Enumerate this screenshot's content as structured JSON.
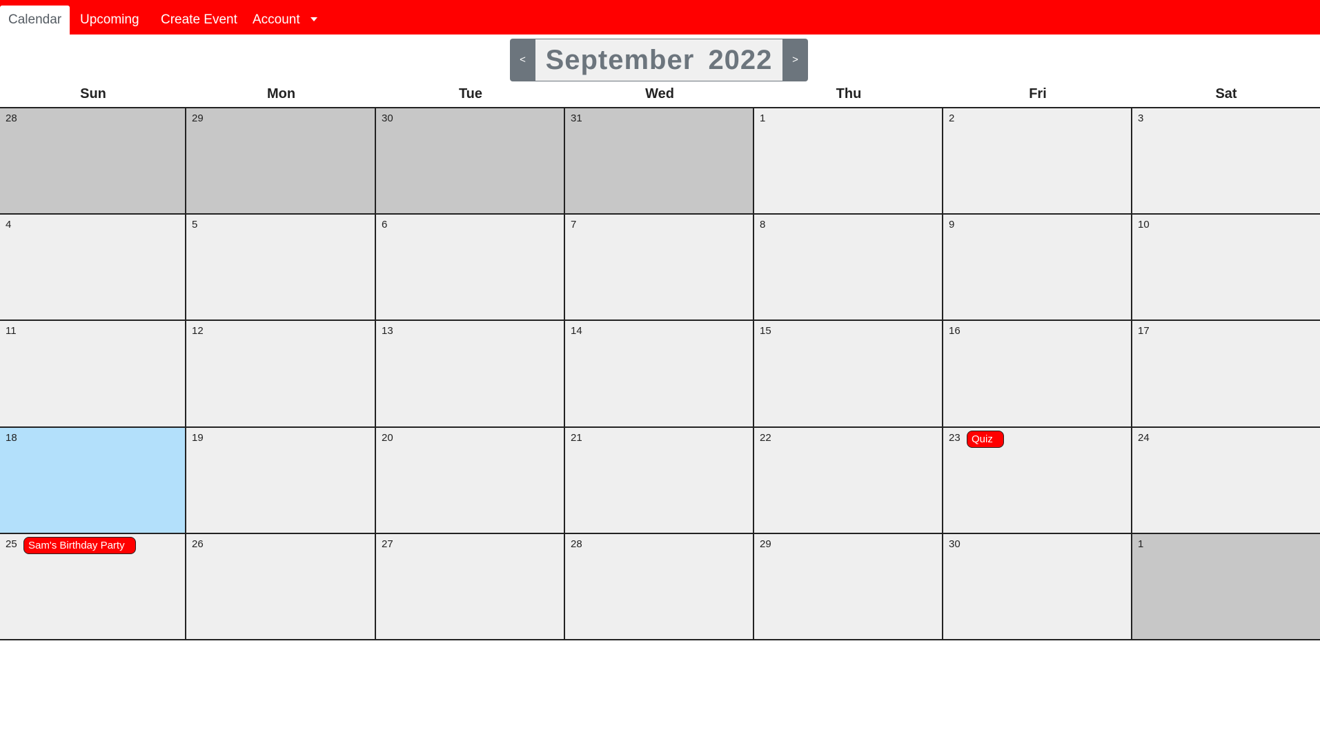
{
  "nav": {
    "items": [
      {
        "label": "Calendar",
        "active": true
      },
      {
        "label": "Upcoming",
        "active": false
      },
      {
        "label": "Create Event",
        "active": false
      },
      {
        "label": "Account",
        "active": false,
        "dropdown": true
      }
    ]
  },
  "header": {
    "prev_label": "<",
    "next_label": ">",
    "month": "September",
    "year": "2022"
  },
  "weekdays": [
    "Sun",
    "Mon",
    "Tue",
    "Wed",
    "Thu",
    "Fri",
    "Sat"
  ],
  "weeks": [
    [
      {
        "day": "28",
        "state": "other"
      },
      {
        "day": "29",
        "state": "other"
      },
      {
        "day": "30",
        "state": "other"
      },
      {
        "day": "31",
        "state": "other"
      },
      {
        "day": "1",
        "state": "current"
      },
      {
        "day": "2",
        "state": "current"
      },
      {
        "day": "3",
        "state": "current"
      }
    ],
    [
      {
        "day": "4",
        "state": "current"
      },
      {
        "day": "5",
        "state": "current"
      },
      {
        "day": "6",
        "state": "current"
      },
      {
        "day": "7",
        "state": "current"
      },
      {
        "day": "8",
        "state": "current"
      },
      {
        "day": "9",
        "state": "current"
      },
      {
        "day": "10",
        "state": "current"
      }
    ],
    [
      {
        "day": "11",
        "state": "current"
      },
      {
        "day": "12",
        "state": "current"
      },
      {
        "day": "13",
        "state": "current"
      },
      {
        "day": "14",
        "state": "current"
      },
      {
        "day": "15",
        "state": "current"
      },
      {
        "day": "16",
        "state": "current"
      },
      {
        "day": "17",
        "state": "current"
      }
    ],
    [
      {
        "day": "18",
        "state": "today"
      },
      {
        "day": "19",
        "state": "current"
      },
      {
        "day": "20",
        "state": "current"
      },
      {
        "day": "21",
        "state": "current"
      },
      {
        "day": "22",
        "state": "current"
      },
      {
        "day": "23",
        "state": "current",
        "events": [
          "Quiz"
        ]
      },
      {
        "day": "24",
        "state": "current"
      }
    ],
    [
      {
        "day": "25",
        "state": "current",
        "events": [
          "Sam's Birthday Party"
        ]
      },
      {
        "day": "26",
        "state": "current"
      },
      {
        "day": "27",
        "state": "current"
      },
      {
        "day": "28",
        "state": "current"
      },
      {
        "day": "29",
        "state": "current"
      },
      {
        "day": "30",
        "state": "current"
      },
      {
        "day": "1",
        "state": "other"
      }
    ]
  ],
  "colors": {
    "navbar": "#ff0000",
    "event": "#ff0000",
    "today": "#b3e0fb",
    "other_month": "#c7c7c7",
    "cell": "#efefef",
    "header_button": "#6c757d"
  }
}
